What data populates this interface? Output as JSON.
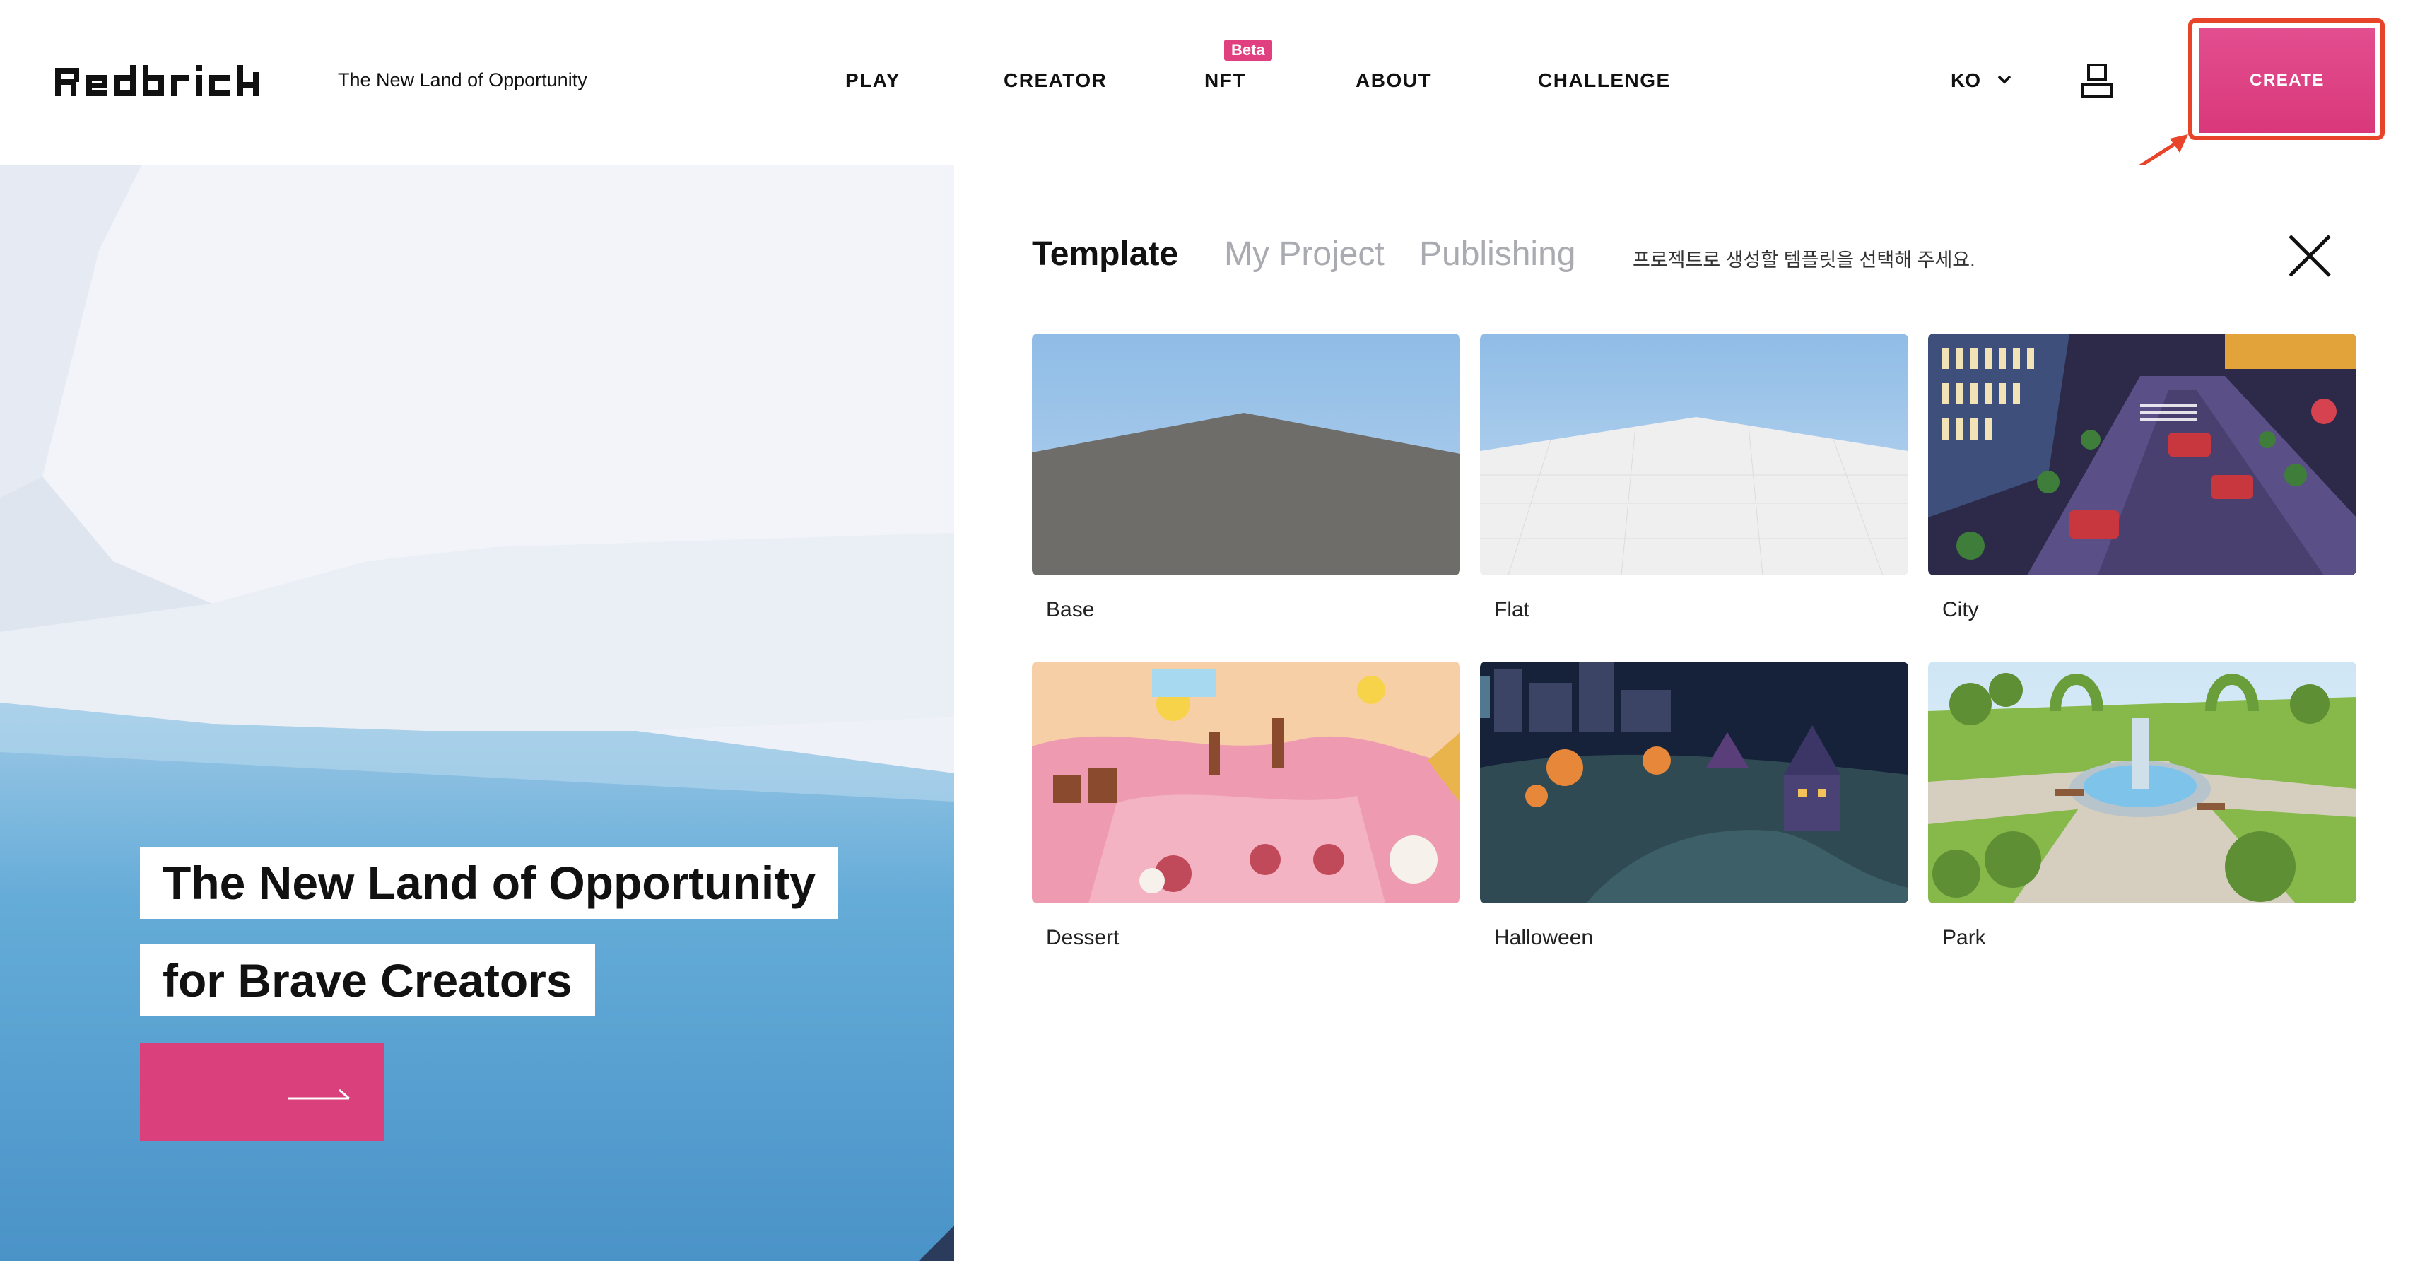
{
  "header": {
    "logo_text": "Redbrick",
    "tagline": "The New Land of Opportunity",
    "nav": [
      {
        "label": "PLAY"
      },
      {
        "label": "CREATOR"
      },
      {
        "label": "NFT",
        "badge": "Beta"
      },
      {
        "label": "ABOUT"
      },
      {
        "label": "CHALLENGE"
      }
    ],
    "language": "KO",
    "create_label": "CREATE",
    "icons": {
      "language_dropdown": "chevron-down-icon",
      "user": "user-icon"
    },
    "accent_color": "#e0407f",
    "annotation_color": "#e8442a"
  },
  "hero": {
    "line1": "The New Land of Opportunity",
    "line2": "for Brave Creators",
    "cta_icon": "arrow-right-icon"
  },
  "panel": {
    "tabs": [
      {
        "label": "Template",
        "active": true
      },
      {
        "label": "My Project",
        "active": false
      },
      {
        "label": "Publishing",
        "active": false
      }
    ],
    "hint": "프로젝트로 생성할 템플릿을 선택해 주세요.",
    "close_icon": "close-icon",
    "templates": [
      {
        "label": "Base"
      },
      {
        "label": "Flat"
      },
      {
        "label": "City"
      },
      {
        "label": "Dessert"
      },
      {
        "label": "Halloween"
      },
      {
        "label": "Park"
      }
    ]
  }
}
